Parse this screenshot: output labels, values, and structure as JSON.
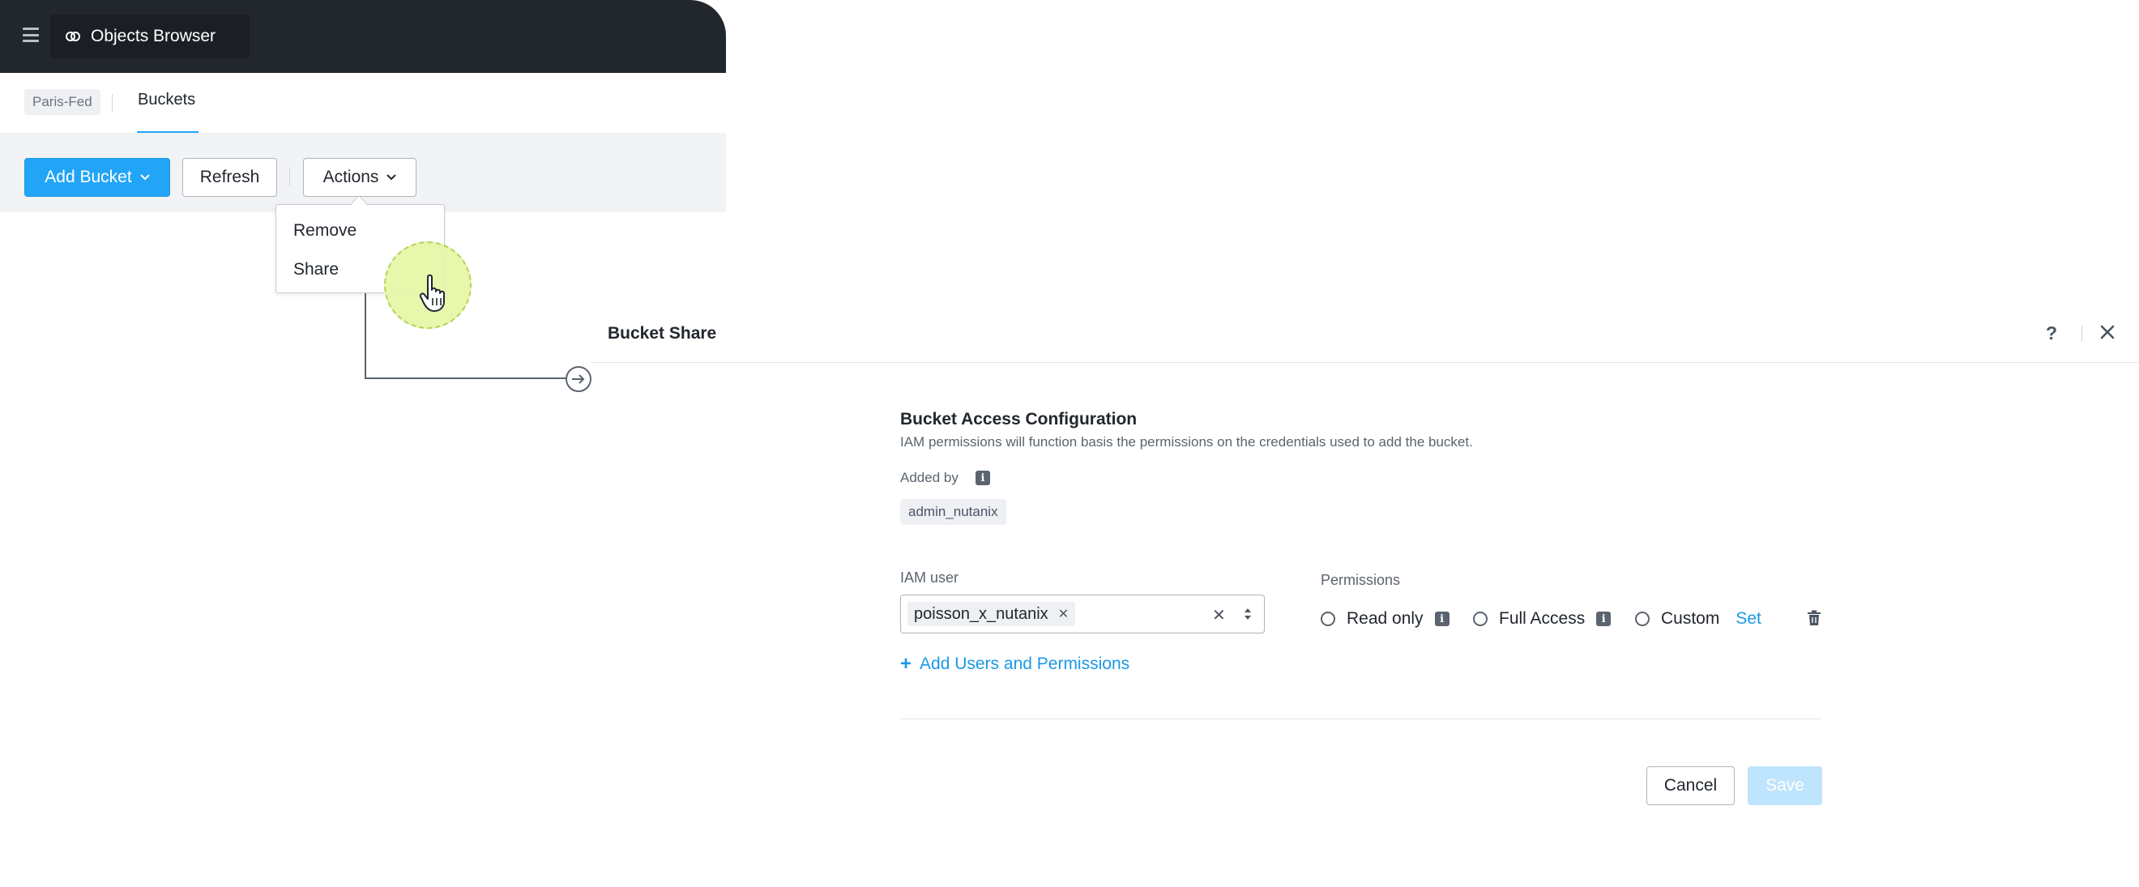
{
  "app": {
    "title": "Objects Browser"
  },
  "breadcrumb": {
    "context": "Paris-Fed",
    "active_tab": "Buckets"
  },
  "toolbar": {
    "add_bucket_label": "Add Bucket",
    "refresh_label": "Refresh",
    "actions_label": "Actions"
  },
  "actions_menu": {
    "items": [
      "Remove",
      "Share"
    ]
  },
  "modal": {
    "title": "Bucket Share",
    "help_label": "?",
    "section_title": "Bucket Access Configuration",
    "section_description": "IAM permissions will function basis the permissions on the credentials used to add the bucket.",
    "added_by_label": "Added by",
    "added_by_value": "admin_nutanix",
    "iam_user_label": "IAM user",
    "iam_user_selected": "poisson_x_nutanix",
    "add_users_label": "Add Users and Permissions",
    "permissions_label": "Permissions",
    "permission_options": [
      "Read only",
      "Full Access",
      "Custom"
    ],
    "custom_set_label": "Set",
    "cancel_label": "Cancel",
    "save_label": "Save"
  },
  "colors": {
    "accent": "#22a5f7",
    "topbar": "#22272e",
    "save_disabled": "#bfe4fd",
    "cursor_halo": "#e6f7a8"
  },
  "icons": [
    "menu-icon",
    "objects-icon",
    "chevron-down-icon",
    "hand-cursor-icon",
    "arrow-right-circle-icon",
    "help-icon",
    "close-icon",
    "info-icon",
    "remove-tag-icon",
    "clear-icon",
    "sort-caret-icon",
    "plus-icon",
    "trash-icon"
  ]
}
